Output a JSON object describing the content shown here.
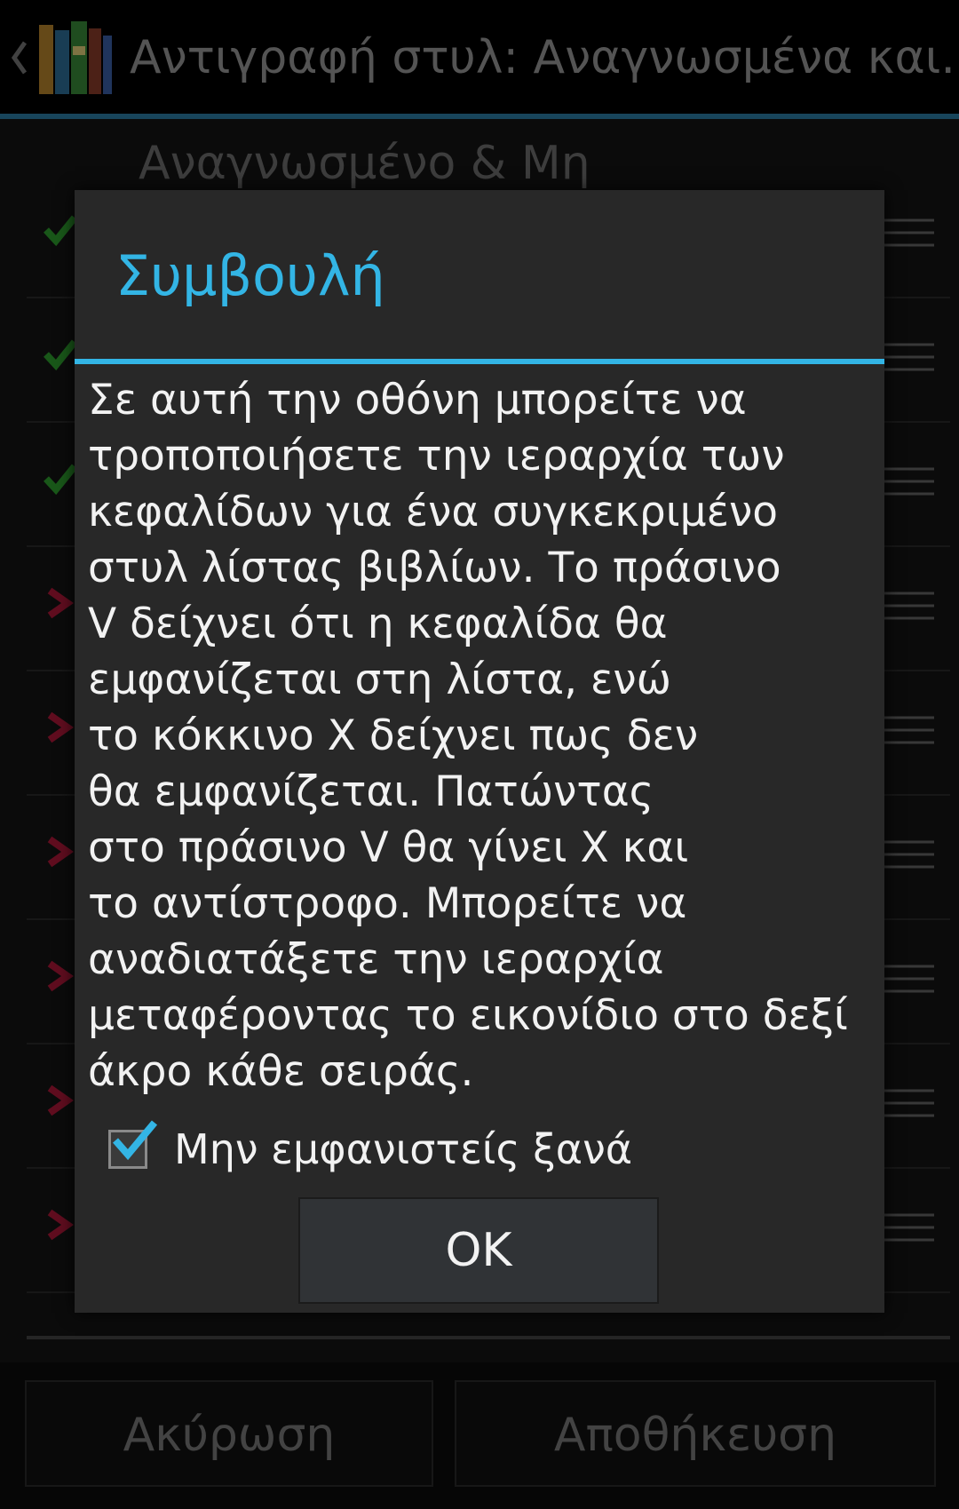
{
  "actionbar": {
    "title": "Αντιγραφή στυλ: Αναγνωσμένα και...",
    "back_icon": "chevron-left-icon",
    "app_icon": "books-icon"
  },
  "list": {
    "header": "Αναγνωσμένο & Μη",
    "rows": [
      {
        "state": "enabled",
        "icon": "green-check-icon"
      },
      {
        "state": "enabled",
        "icon": "green-check-icon"
      },
      {
        "state": "enabled",
        "icon": "green-check-icon"
      },
      {
        "state": "disabled",
        "icon": "red-x-icon"
      },
      {
        "state": "disabled",
        "icon": "red-x-icon"
      },
      {
        "state": "disabled",
        "icon": "red-x-icon"
      },
      {
        "state": "disabled",
        "icon": "red-x-icon"
      },
      {
        "state": "disabled",
        "icon": "red-x-icon"
      },
      {
        "state": "disabled",
        "icon": "red-x-icon"
      }
    ]
  },
  "dialog": {
    "title": "Συμβουλή",
    "message": "Σε αυτή την οθόνη μπορείτε να\nτροποποιήσετε την ιεραρχία των\nκεφαλίδων για ένα συγκεκριμένο\nστυλ λίστας βιβλίων. Το πράσινο\nV δείχνει ότι η κεφαλίδα θα\nεμφανίζεται στη λίστα, ενώ\nτο κόκκινο X δείχνει πως δεν\nθα εμφανίζεται. Πατώντας\nστο πράσινο V θα γίνει X και\nτο αντίστροφο. Μπορείτε να\nαναδιατάξετε την ιεραρχία\nμεταφέροντας το εικονίδιο στο δεξί\nάκρο κάθε σειράς.",
    "checkbox_label": "Μην εμφανιστείς ξανά",
    "checkbox_checked": true,
    "ok_label": "OK"
  },
  "buttons": {
    "cancel_label": "Ακύρωση",
    "save_label": "Αποθήκευση"
  },
  "colors": {
    "accent": "#33b5e5",
    "check_green": "#2e9e2e",
    "x_red": "#b0183a"
  }
}
